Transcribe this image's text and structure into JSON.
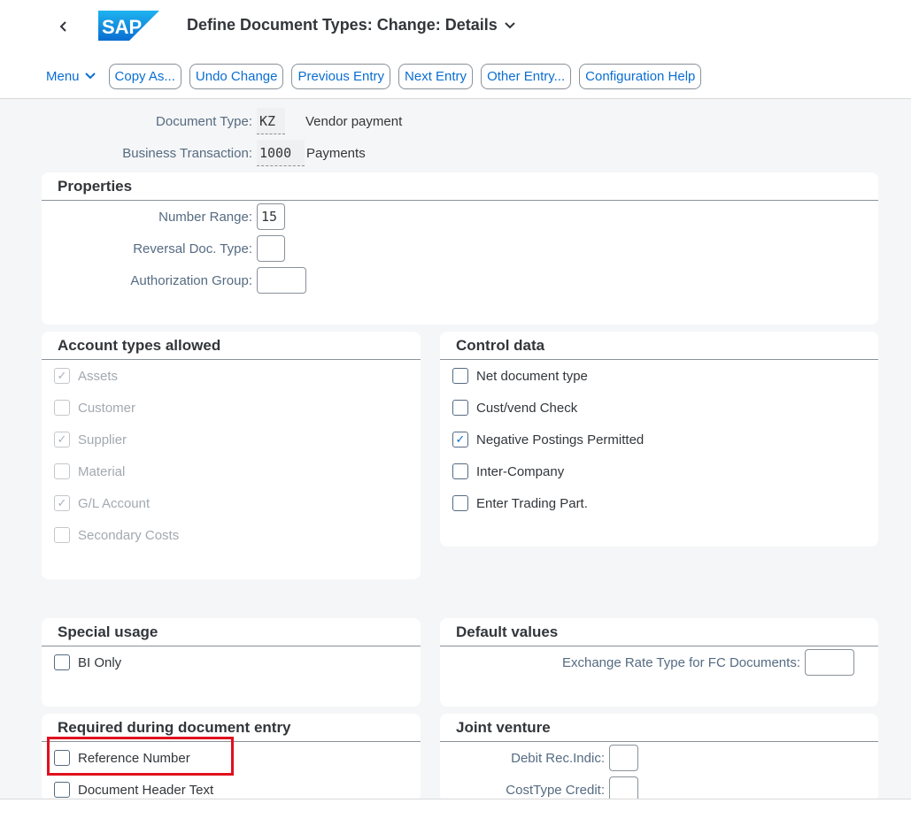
{
  "header": {
    "title": "Define Document Types: Change: Details",
    "logo_text": "SAP",
    "back_icon": "chevron-left-icon",
    "title_icon": "chevron-down-icon"
  },
  "toolbar": {
    "menu_label": "Menu",
    "buttons": [
      "Copy As...",
      "Undo Change",
      "Previous Entry",
      "Next Entry",
      "Other Entry...",
      "Configuration Help"
    ]
  },
  "doc_header": {
    "document_type_label": "Document Type:",
    "document_type_value": "KZ",
    "document_type_desc": "Vendor payment",
    "business_transaction_label": "Business Transaction:",
    "business_transaction_value": "1000",
    "business_transaction_desc": "Payments"
  },
  "properties": {
    "title": "Properties",
    "number_range_label": "Number Range:",
    "number_range_value": "15",
    "reversal_label": "Reversal Doc. Type:",
    "reversal_value": "",
    "auth_group_label": "Authorization Group:",
    "auth_group_value": ""
  },
  "account_types": {
    "title": "Account types allowed",
    "items": [
      {
        "label": "Assets",
        "checked": true
      },
      {
        "label": "Customer",
        "checked": false
      },
      {
        "label": "Supplier",
        "checked": true
      },
      {
        "label": "Material",
        "checked": false
      },
      {
        "label": "G/L Account",
        "checked": true
      },
      {
        "label": "Secondary Costs",
        "checked": false
      }
    ]
  },
  "control_data": {
    "title": "Control data",
    "items": [
      {
        "label": "Net document type",
        "checked": false
      },
      {
        "label": "Cust/vend Check",
        "checked": false
      },
      {
        "label": "Negative Postings Permitted",
        "checked": true
      },
      {
        "label": "Inter-Company",
        "checked": false
      },
      {
        "label": "Enter Trading Part.",
        "checked": false
      }
    ]
  },
  "special_usage": {
    "title": "Special usage",
    "bi_only_label": "BI Only"
  },
  "default_values": {
    "title": "Default values",
    "exchange_rate_label": "Exchange Rate Type for FC Documents:",
    "exchange_rate_value": ""
  },
  "required_entry": {
    "title": "Required during document entry",
    "reference_number_label": "Reference Number",
    "header_text_label": "Document Header Text"
  },
  "joint_venture": {
    "title": "Joint venture",
    "debit_label": "Debit Rec.Indic:",
    "debit_value": "",
    "costtype_label": "CostType Credit:",
    "costtype_value": ""
  },
  "colors": {
    "accent": "#0a6ed1",
    "highlight": "#e0101d",
    "brand": "#0a6ed1"
  }
}
